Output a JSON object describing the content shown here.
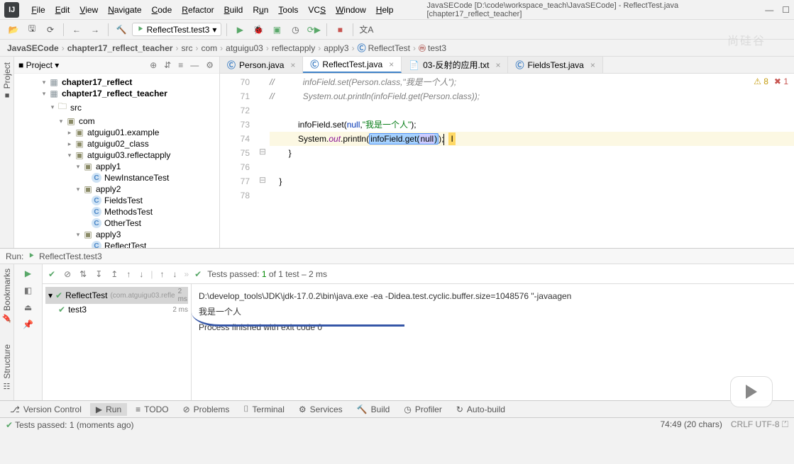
{
  "window": {
    "title": "JavaSECode [D:\\code\\workspace_teach\\JavaSECode] - ReflectTest.java [chapter17_reflect_teacher]"
  },
  "menu": {
    "file": "File",
    "edit": "Edit",
    "view": "View",
    "navigate": "Navigate",
    "code": "Code",
    "refactor": "Refactor",
    "build": "Build",
    "run": "Run",
    "tools": "Tools",
    "vcs": "VCS",
    "window": "Window",
    "help": "Help"
  },
  "runcfg": "ReflectTest.test3",
  "breadcrumbs": [
    "JavaSECode",
    "chapter17_reflect_teacher",
    "src",
    "com",
    "atguigu03",
    "reflectapply",
    "apply3",
    "ReflectTest",
    "test3"
  ],
  "project_label": "Project",
  "tree": [
    {
      "d": 3,
      "tw": "▾",
      "ic": "dir",
      "t": "chapter17_reflect",
      "bold": true
    },
    {
      "d": 3,
      "tw": "▾",
      "ic": "dir",
      "t": "chapter17_reflect_teacher",
      "bold": true
    },
    {
      "d": 4,
      "tw": "▾",
      "ic": "folder",
      "t": "src"
    },
    {
      "d": 5,
      "tw": "▾",
      "ic": "pkg",
      "t": "com"
    },
    {
      "d": 6,
      "tw": "▸",
      "ic": "pkg",
      "t": "atguigu01.example"
    },
    {
      "d": 6,
      "tw": "▸",
      "ic": "pkg",
      "t": "atguigu02_class"
    },
    {
      "d": 6,
      "tw": "▾",
      "ic": "pkg",
      "t": "atguigu03.reflectapply"
    },
    {
      "d": 7,
      "tw": "▾",
      "ic": "pkg",
      "t": "apply1"
    },
    {
      "d": 8,
      "tw": "",
      "ic": "cls",
      "t": "NewInstanceTest"
    },
    {
      "d": 7,
      "tw": "▾",
      "ic": "pkg",
      "t": "apply2"
    },
    {
      "d": 8,
      "tw": "",
      "ic": "cls",
      "t": "FieldsTest"
    },
    {
      "d": 8,
      "tw": "",
      "ic": "cls",
      "t": "MethodsTest"
    },
    {
      "d": 8,
      "tw": "",
      "ic": "cls",
      "t": "OtherTest"
    },
    {
      "d": 7,
      "tw": "▾",
      "ic": "pkg",
      "t": "apply3"
    },
    {
      "d": 8,
      "tw": "",
      "ic": "cls",
      "t": "ReflectTest"
    }
  ],
  "editor_tabs": [
    {
      "t": "Person.java",
      "ic": "C",
      "active": false
    },
    {
      "t": "ReflectTest.java",
      "ic": "C",
      "active": true
    },
    {
      "t": "03-反射的应用.txt",
      "ic": "≡",
      "active": false
    },
    {
      "t": "FieldsTest.java",
      "ic": "C",
      "active": false
    }
  ],
  "line_start": 70,
  "code": {
    "l70_pre": "//            ",
    "l70_body": "infoField.set(Person.class,\"我是一个人\");",
    "l71_pre": "//            ",
    "l71_body": "System.out.println(infoField.get(Person.class));",
    "l73_a": "            infoField.set(",
    "l73_null": "null",
    "l73_b": ",",
    "l73_str": "\"我是一个人\"",
    "l73_c": ");",
    "l74_a": "            System.",
    "l74_out": "out",
    "l74_b": ".println(",
    "l74_sel": "infoField.get(",
    "l74_null": "null",
    "l74_sel2": ")",
    "l74_c": ");",
    "l75": "        }",
    "l77": "    }"
  },
  "warns": {
    "a": "8",
    "e": "1"
  },
  "left_tabs": {
    "project": "Project"
  },
  "run": {
    "header": "ReflectTest.test3",
    "toolbar_text": "Tests passed: 1 of 1 test – 2 ms",
    "tree": [
      {
        "t": "ReflectTest",
        "sub": "(com.atguigu03.refle",
        "tm": "2 ms",
        "sel": true
      },
      {
        "t": "test3",
        "tm": "2 ms",
        "sel": false
      }
    ],
    "console": [
      "D:\\develop_tools\\JDK\\jdk-17.0.2\\bin\\java.exe -ea -Didea.test.cyclic.buffer.size=1048576 \"-javaagen",
      "我是一个人",
      "",
      "Process finished with exit code 0"
    ]
  },
  "run_side": {
    "bookmarks": "Bookmarks",
    "structure": "Structure"
  },
  "bottom": [
    {
      "ic": "⎇",
      "t": "Version Control"
    },
    {
      "ic": "▶",
      "t": "Run",
      "active": true
    },
    {
      "ic": "≡",
      "t": "TODO"
    },
    {
      "ic": "⊘",
      "t": "Problems"
    },
    {
      "ic": "⌷",
      "t": "Terminal"
    },
    {
      "ic": "⚙",
      "t": "Services"
    },
    {
      "ic": "🔨",
      "t": "Build"
    },
    {
      "ic": "◷",
      "t": "Profiler"
    },
    {
      "ic": "↻",
      "t": "Auto-build"
    }
  ],
  "status": {
    "left": "Tests passed: 1 (moments ago)",
    "right": "74:49 (20 chars)"
  },
  "watermark": "尚硅谷"
}
